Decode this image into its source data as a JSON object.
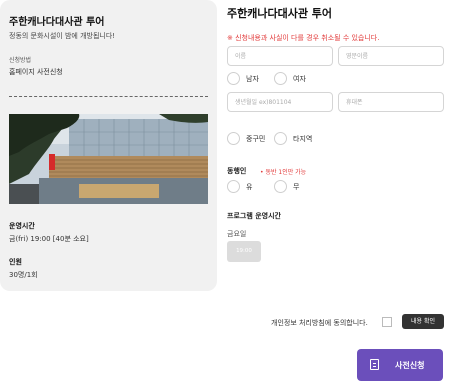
{
  "tour": {
    "title": "주한캐나다대사관 투어",
    "subtitle": "정동의 문화시설이 밤에 개방됩니다!",
    "method_label": "신청방법",
    "method_value": "홈페이지 사전신청",
    "hours_label": "운영시간",
    "hours_value": "금(fri) 19:00 [40분 소요]",
    "capacity_label": "인원",
    "capacity_value": "30명/1회"
  },
  "form": {
    "title": "주한캐나다대사관 투어",
    "notice": "※ 신청내용과 사실이 다를 경우 취소될 수 있습니다.",
    "name_placeholder": "이름",
    "english_name_placeholder": "영문이름",
    "gender_options": [
      "남자",
      "여자"
    ],
    "birth_placeholder": "생년월일 ex)801104",
    "phone_placeholder": "휴대폰",
    "district_options": [
      "중구민",
      "타지역"
    ],
    "companion_label": "동행인",
    "companion_note": "• 동반 1인만 가능",
    "companion_options": [
      "유",
      "무"
    ],
    "schedule_label": "프로그램 운영시간",
    "schedule_day": "금요일",
    "time_slot": "19:00",
    "agree_text": "개인정보 처리방침에 동의합니다.",
    "view_button": "내용 확인",
    "submit_button": "사전신청"
  },
  "colors": {
    "accent": "#6b4fbb",
    "notice": "#e23b3b"
  }
}
